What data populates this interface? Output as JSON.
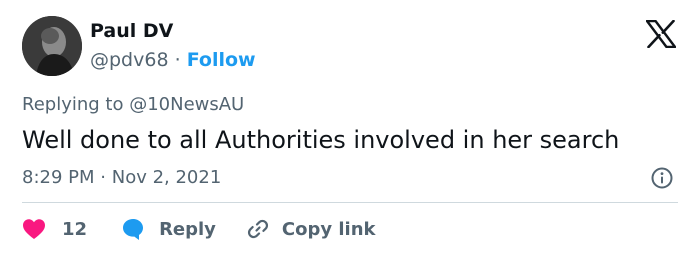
{
  "author": {
    "name": "Paul DV",
    "handle": "@pdv68",
    "separator": "·",
    "follow_label": "Follow",
    "avatar_icon": "user-avatar-icon"
  },
  "platform_icon": "x-logo-icon",
  "tweet": {
    "reply_prefix": "Replying to ",
    "reply_handle": "@10NewsAU",
    "text": "Well done to all Authorities involved in her search",
    "time": "8:29 PM",
    "date_separator": "·",
    "date": "Nov 2, 2021"
  },
  "actions": {
    "like_count": "12",
    "reply_label": "Reply",
    "copy_label": "Copy link"
  },
  "colors": {
    "accent": "#1d9bf0",
    "secondary_text": "#536471",
    "primary_text": "#0f1419",
    "like": "#f91880",
    "reply_bubble": "#1d9bf0",
    "divider": "#cfd9de"
  }
}
